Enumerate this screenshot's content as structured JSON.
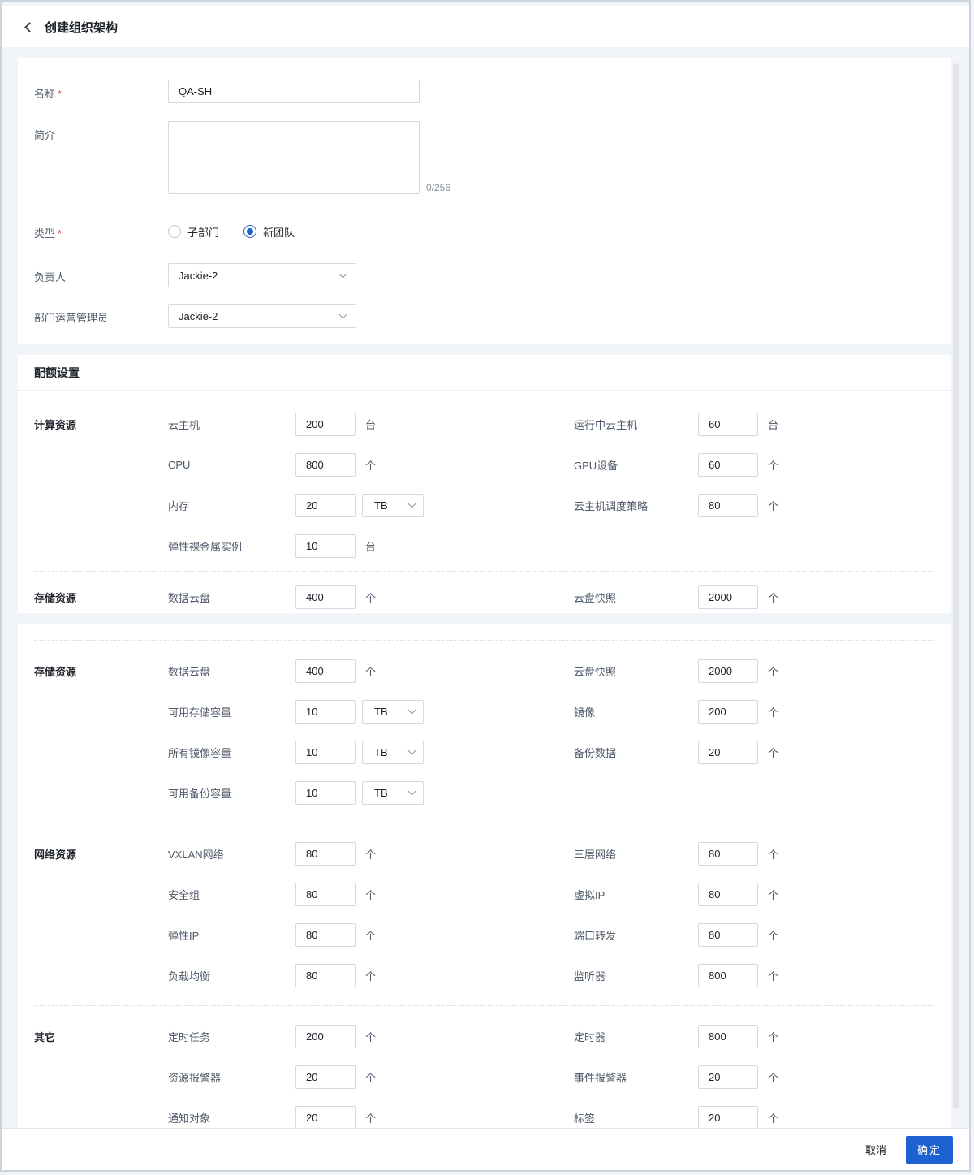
{
  "header": {
    "title": "创建组织架构"
  },
  "form": {
    "name": {
      "label": "名称",
      "required": "*",
      "value": "QA-SH"
    },
    "intro": {
      "label": "简介",
      "value": "",
      "counter": "0/256"
    },
    "type": {
      "label": "类型",
      "required": "*",
      "options": [
        {
          "label": "子部门",
          "selected": false
        },
        {
          "label": "新团队",
          "selected": true
        }
      ]
    },
    "owner": {
      "label": "负责人",
      "value": "Jackie-2"
    },
    "admin": {
      "label": "部门运营管理员",
      "value": "Jackie-2"
    }
  },
  "quota": {
    "title": "配额设置",
    "panel1": {
      "rows": [
        {
          "group": "计算资源",
          "left": {
            "label": "云主机",
            "value": "200",
            "unit": "台"
          },
          "right": {
            "label": "运行中云主机",
            "value": "60",
            "unit": "台"
          }
        },
        {
          "left": {
            "label": "CPU",
            "value": "800",
            "unit": "个"
          },
          "right": {
            "label": "GPU设备",
            "value": "60",
            "unit": "个"
          }
        },
        {
          "left": {
            "label": "内存",
            "value": "20",
            "unit_select": "TB"
          },
          "right": {
            "label": "云主机调度策略",
            "value": "80",
            "unit": "个"
          }
        },
        {
          "left": {
            "label": "弹性裸金属实例",
            "value": "10",
            "unit": "台"
          }
        },
        {
          "divider": true
        },
        {
          "group": "存储资源",
          "left": {
            "label": "数据云盘",
            "value": "400",
            "unit": "个"
          },
          "right": {
            "label": "云盘快照",
            "value": "2000",
            "unit": "个"
          }
        }
      ]
    },
    "panel2": {
      "rows": [
        {
          "divider": true
        },
        {
          "group": "存储资源",
          "left": {
            "label": "数据云盘",
            "value": "400",
            "unit": "个"
          },
          "right": {
            "label": "云盘快照",
            "value": "2000",
            "unit": "个"
          }
        },
        {
          "left": {
            "label": "可用存储容量",
            "value": "10",
            "unit_select": "TB"
          },
          "right": {
            "label": "镜像",
            "value": "200",
            "unit": "个"
          }
        },
        {
          "left": {
            "label": "所有镜像容量",
            "value": "10",
            "unit_select": "TB"
          },
          "right": {
            "label": "备份数据",
            "value": "20",
            "unit": "个"
          }
        },
        {
          "left": {
            "label": "可用备份容量",
            "value": "10",
            "unit_select": "TB"
          }
        },
        {
          "divider": true
        },
        {
          "group": "网络资源",
          "left": {
            "label": "VXLAN网络",
            "value": "80",
            "unit": "个"
          },
          "right": {
            "label": "三层网络",
            "value": "80",
            "unit": "个"
          }
        },
        {
          "left": {
            "label": "安全组",
            "value": "80",
            "unit": "个"
          },
          "right": {
            "label": "虚拟IP",
            "value": "80",
            "unit": "个"
          }
        },
        {
          "left": {
            "label": "弹性IP",
            "value": "80",
            "unit": "个"
          },
          "right": {
            "label": "端口转发",
            "value": "80",
            "unit": "个"
          }
        },
        {
          "left": {
            "label": "负载均衡",
            "value": "80",
            "unit": "个"
          },
          "right": {
            "label": "监听器",
            "value": "800",
            "unit": "个"
          }
        },
        {
          "divider": true
        },
        {
          "group": "其它",
          "left": {
            "label": "定时任务",
            "value": "200",
            "unit": "个"
          },
          "right": {
            "label": "定时器",
            "value": "800",
            "unit": "个"
          }
        },
        {
          "left": {
            "label": "资源报警器",
            "value": "20",
            "unit": "个"
          },
          "right": {
            "label": "事件报警器",
            "value": "20",
            "unit": "个"
          }
        },
        {
          "left": {
            "label": "通知对象",
            "value": "20",
            "unit": "个"
          },
          "right": {
            "label": "标签",
            "value": "20",
            "unit": "个"
          }
        }
      ]
    }
  },
  "footer": {
    "cancel": "取消",
    "confirm": "确定"
  },
  "colors": {
    "primary": "#1E62D2"
  }
}
